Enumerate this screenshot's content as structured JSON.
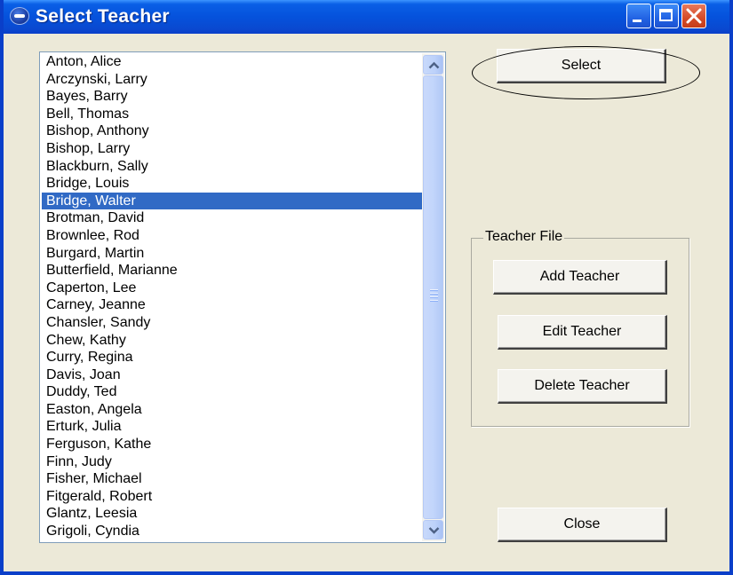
{
  "window": {
    "title": "Select Teacher"
  },
  "teachers": [
    "Anton, Alice",
    "Arczynski, Larry",
    "Bayes, Barry",
    "Bell, Thomas",
    "Bishop, Anthony",
    "Bishop, Larry",
    "Blackburn, Sally",
    "Bridge, Louis",
    "Bridge, Walter",
    "Brotman, David",
    "Brownlee, Rod",
    "Burgard, Martin",
    "Butterfield, Marianne",
    "Caperton, Lee",
    "Carney, Jeanne",
    "Chansler, Sandy",
    "Chew, Kathy",
    "Curry, Regina",
    "Davis, Joan",
    "Duddy, Ted",
    "Easton, Angela",
    "Erturk, Julia",
    "Ferguson, Kathe",
    "Finn, Judy",
    "Fisher, Michael",
    "Fitgerald, Robert",
    "Glantz, Leesia",
    "Grigoli, Cyndia"
  ],
  "selected_teacher": "Bridge, Walter",
  "buttons": {
    "select": "Select",
    "add_teacher": "Add Teacher",
    "edit_teacher": "Edit Teacher",
    "delete_teacher": "Delete Teacher",
    "close": "Close"
  },
  "group": {
    "label": "Teacher File"
  },
  "icons": {
    "app": "app-logo-icon",
    "minimize": "minimize-icon",
    "maximize": "maximize-icon",
    "close": "close-icon",
    "scroll_up": "arrow-up-icon",
    "scroll_down": "arrow-down-icon"
  },
  "colors": {
    "titlebar": "#0552dc",
    "selection": "#316ac5",
    "dialog_bg": "#ece9d8",
    "close_button": "#d54b28"
  }
}
